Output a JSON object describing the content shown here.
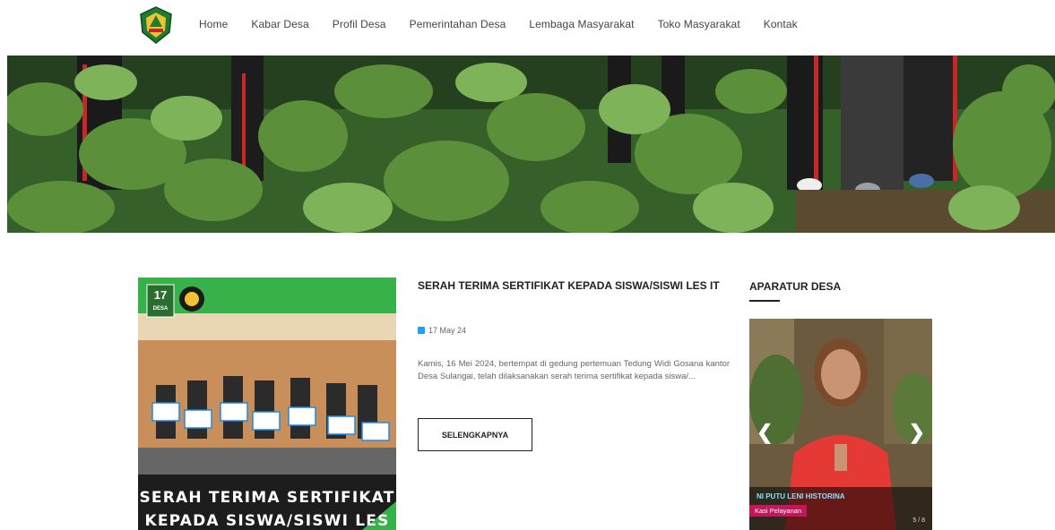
{
  "nav": {
    "logo_icon": "village-emblem-icon",
    "items": [
      "Home",
      "Kabar Desa",
      "Profil Desa",
      "Pemerintahan Desa",
      "Lembaga Masyarakat",
      "Toko Masyarakat",
      "Kontak"
    ]
  },
  "hero": {
    "icon": "eggplant-field-photo"
  },
  "post": {
    "thumb_badge": "17",
    "thumb_badge_sub": "DESA",
    "thumb_title_line1": "SERAH TERIMA SERTIFIKAT",
    "thumb_title_line2": "KEPADA SISWA/SISWI LES IT",
    "title": "SERAH TERIMA SERTIFIKAT KEPADA SISWA/SISWI LES IT",
    "date": "17 May 24",
    "excerpt": "Kamis, 16 Mei 2024, bertempat di gedung pertemuan Tedung Widi Gosana kantor Desa Sulangai, telah dilaksanakan serah terima sertifikat kepada siswa/...",
    "button": "SELENGKAPNYA"
  },
  "sidebar": {
    "title": "APARATUR DESA",
    "prev": "❮",
    "next": "❯",
    "person_name": "NI PUTU LENI HISTORINA",
    "person_role": "Kasi Pelayanan",
    "page_indicator": "5 / 8"
  }
}
